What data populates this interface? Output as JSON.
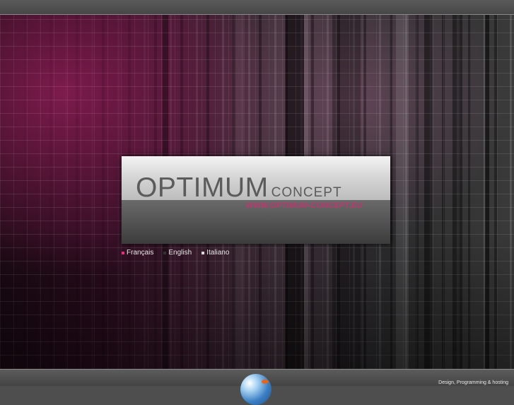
{
  "logo": {
    "main": "OPTIMUM",
    "sub": "CONCEPT",
    "url": "WWW.OPTIMUM-CONCEPT.EU"
  },
  "languages": [
    {
      "label": "Français",
      "color": "#e0307a"
    },
    {
      "label": "English",
      "color": "#333333"
    },
    {
      "label": "Italiano",
      "color": "#d8d8d8"
    }
  ],
  "footer": {
    "credit": "Design, Programming & hosting"
  },
  "colors": {
    "accent": "#c0366f",
    "logo_text": "#5b5b5b"
  }
}
